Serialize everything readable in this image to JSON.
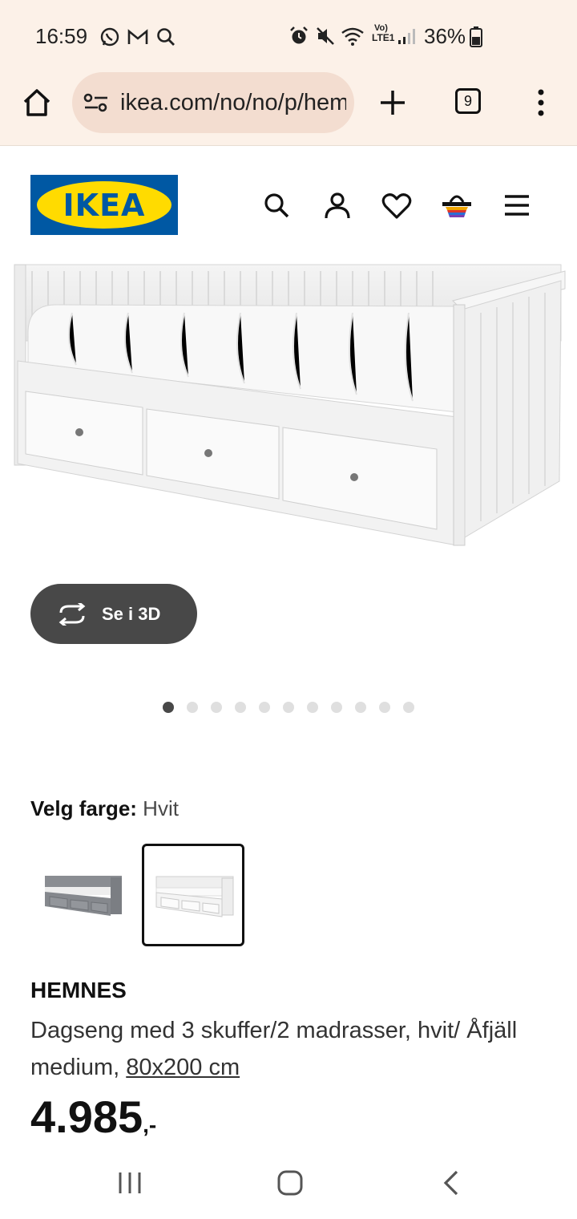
{
  "status_bar": {
    "time": "16:59",
    "battery": "36%",
    "network": "LTE1"
  },
  "browser": {
    "url": "ikea.com/no/no/p/hemnes",
    "tab_count": "9"
  },
  "header": {
    "logo_text": "IKEA",
    "icons": [
      "search-icon",
      "account-icon",
      "favourites-icon",
      "basket-icon",
      "menu-icon"
    ]
  },
  "gallery": {
    "view_3d_label": "Se i 3D",
    "image_count": 11,
    "active_index": 0
  },
  "color_picker": {
    "label": "Velg farge:",
    "selected": "Hvit",
    "options": [
      {
        "name": "Grå",
        "selected": false
      },
      {
        "name": "Hvit",
        "selected": true
      }
    ]
  },
  "product": {
    "name": "HEMNES",
    "description": "Dagseng med 3 skuffer/2 madrasser, hvit/ Åfjäll medium, ",
    "size": "80x200 cm",
    "price": "4.985",
    "price_suffix": ",-"
  },
  "colors": {
    "ikea_blue": "#0058a3",
    "ikea_yellow": "#ffdb00",
    "button_dark": "#484848"
  }
}
